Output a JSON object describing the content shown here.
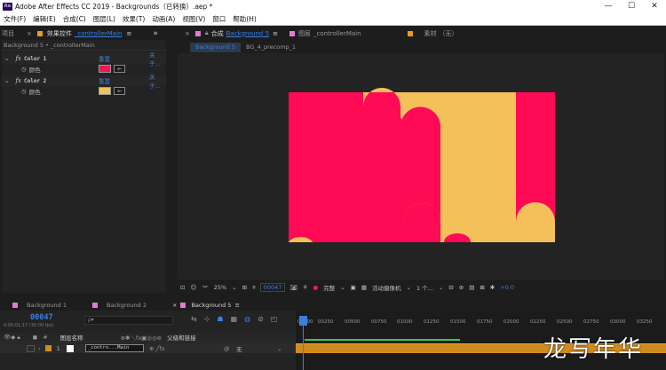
{
  "window": {
    "logo": "Ae",
    "title": "Adobe After Effects CC 2019 - Backgrounds（已转换）.aep *",
    "controls": [
      "—",
      "☐",
      "✕"
    ]
  },
  "menu": [
    "文件(F)",
    "编辑(E)",
    "合成(C)",
    "图层(L)",
    "效果(T)",
    "动画(A)",
    "视图(V)",
    "窗口",
    "帮助(H)"
  ],
  "left_tabs": {
    "project": "项目",
    "effect_controls": "效果控件",
    "effect_controls_target": "_controllerMain",
    "menu_icon": "≡",
    "more": "»"
  },
  "effect_controls": {
    "header": "Background 5 • _controllerMain",
    "effects": [
      {
        "name": "Color 1",
        "reset": "重置",
        "about": "关于...",
        "prop": "颜色",
        "color": "#ff1050"
      },
      {
        "name": "Color 2",
        "reset": "重置",
        "about": "关于...",
        "prop": "颜色",
        "color": "#f3c05a"
      }
    ]
  },
  "comp_tabs": {
    "close": "×",
    "comp_label": "合成",
    "comp_name": "Background 5",
    "menu_icon": "≡",
    "layer_label": "图层",
    "layer_name": "_controllerMain",
    "footage_label": "素材",
    "footage_value": "（无）",
    "breadcrumb": [
      "Background 5",
      "BG_4_precomp_1"
    ]
  },
  "canvas": {
    "pink": "#ff0a55",
    "yellow": "#f3c05a",
    "background": "#232323"
  },
  "viewer_bar": {
    "zoom": "25%",
    "timecode": "00047",
    "resolution": "完整",
    "camera": "活动摄像机",
    "views": "1 个...",
    "exposure": "+0.0"
  },
  "timeline_tabs": [
    {
      "name": "Background 1",
      "color": "#e27bd6",
      "active": false
    },
    {
      "name": "Background 2",
      "color": "#e27bd6",
      "active": false
    },
    {
      "name": "Background 5",
      "color": "#e27bd6",
      "active": true
    }
  ],
  "timeline": {
    "current_time": "00047",
    "fps_info": "0:00:01:17 (30.00 fps)",
    "search_placeholder": "ρ▾",
    "columns": {
      "name": "图层名称",
      "parent": "父级和链接"
    },
    "layers": [
      {
        "index": "1",
        "name": "_contro...Main",
        "parent": "无",
        "label_color": "#cf8b1e"
      }
    ],
    "ruler": [
      "00000",
      "00250",
      "00500",
      "00750",
      "01000",
      "01250",
      "01500",
      "01750",
      "02000",
      "02250",
      "02500",
      "02750",
      "03000",
      "03250"
    ]
  },
  "watermark": "龙写年华"
}
